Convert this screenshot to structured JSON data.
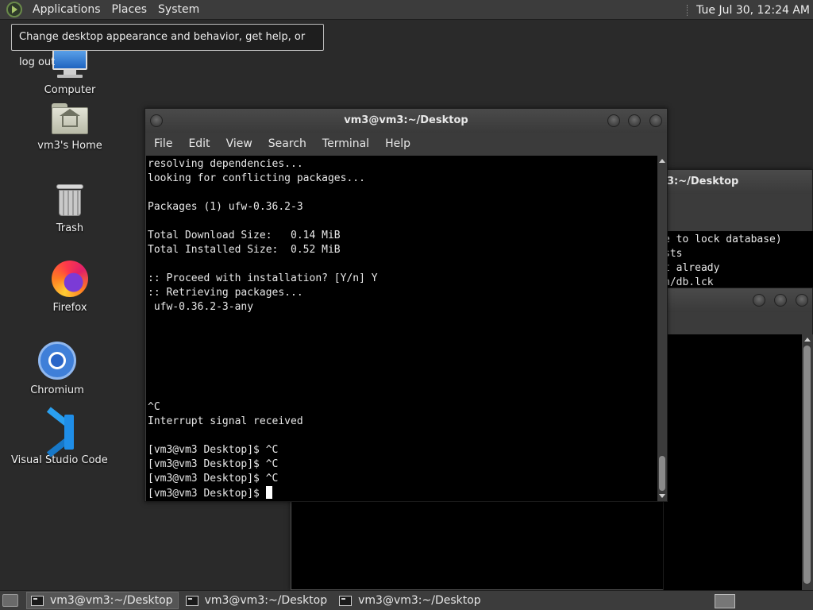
{
  "top_panel": {
    "menus": [
      "Applications",
      "Places",
      "System"
    ],
    "clock": "Tue Jul 30, 12:24 AM"
  },
  "tooltip": "Change desktop appearance and behavior, get help, or log out",
  "desktop_icons": {
    "computer": "Computer",
    "home": "vm3's Home",
    "trash": "Trash",
    "firefox": "Firefox",
    "chromium": "Chromium",
    "vscode": "Visual Studio Code"
  },
  "main_terminal": {
    "title": "vm3@vm3:~/Desktop",
    "menu": [
      "File",
      "Edit",
      "View",
      "Search",
      "Terminal",
      "Help"
    ],
    "lines": [
      "resolving dependencies...",
      "looking for conflicting packages...",
      "",
      "Packages (1) ufw-0.36.2-3",
      "",
      "Total Download Size:   0.14 MiB",
      "Total Installed Size:  0.52 MiB",
      "",
      ":: Proceed with installation? [Y/n] Y",
      ":: Retrieving packages...",
      " ufw-0.36.2-3-any",
      "",
      "",
      "",
      "",
      "",
      "",
      "^C",
      "Interrupt signal received",
      "",
      "[vm3@vm3 Desktop]$ ^C",
      "[vm3@vm3 Desktop]$ ^C",
      "[vm3@vm3 Desktop]$ ^C"
    ],
    "prompt": "[vm3@vm3 Desktop]$ "
  },
  "back_terminal_1": {
    "title_partial": "3:~/Desktop",
    "lines": [
      "e to lock database)",
      "sts",
      "t already",
      "n/db.lck"
    ]
  },
  "taskbar": {
    "tasks": [
      "vm3@vm3:~/Desktop",
      "vm3@vm3:~/Desktop",
      "vm3@vm3:~/Desktop"
    ]
  }
}
